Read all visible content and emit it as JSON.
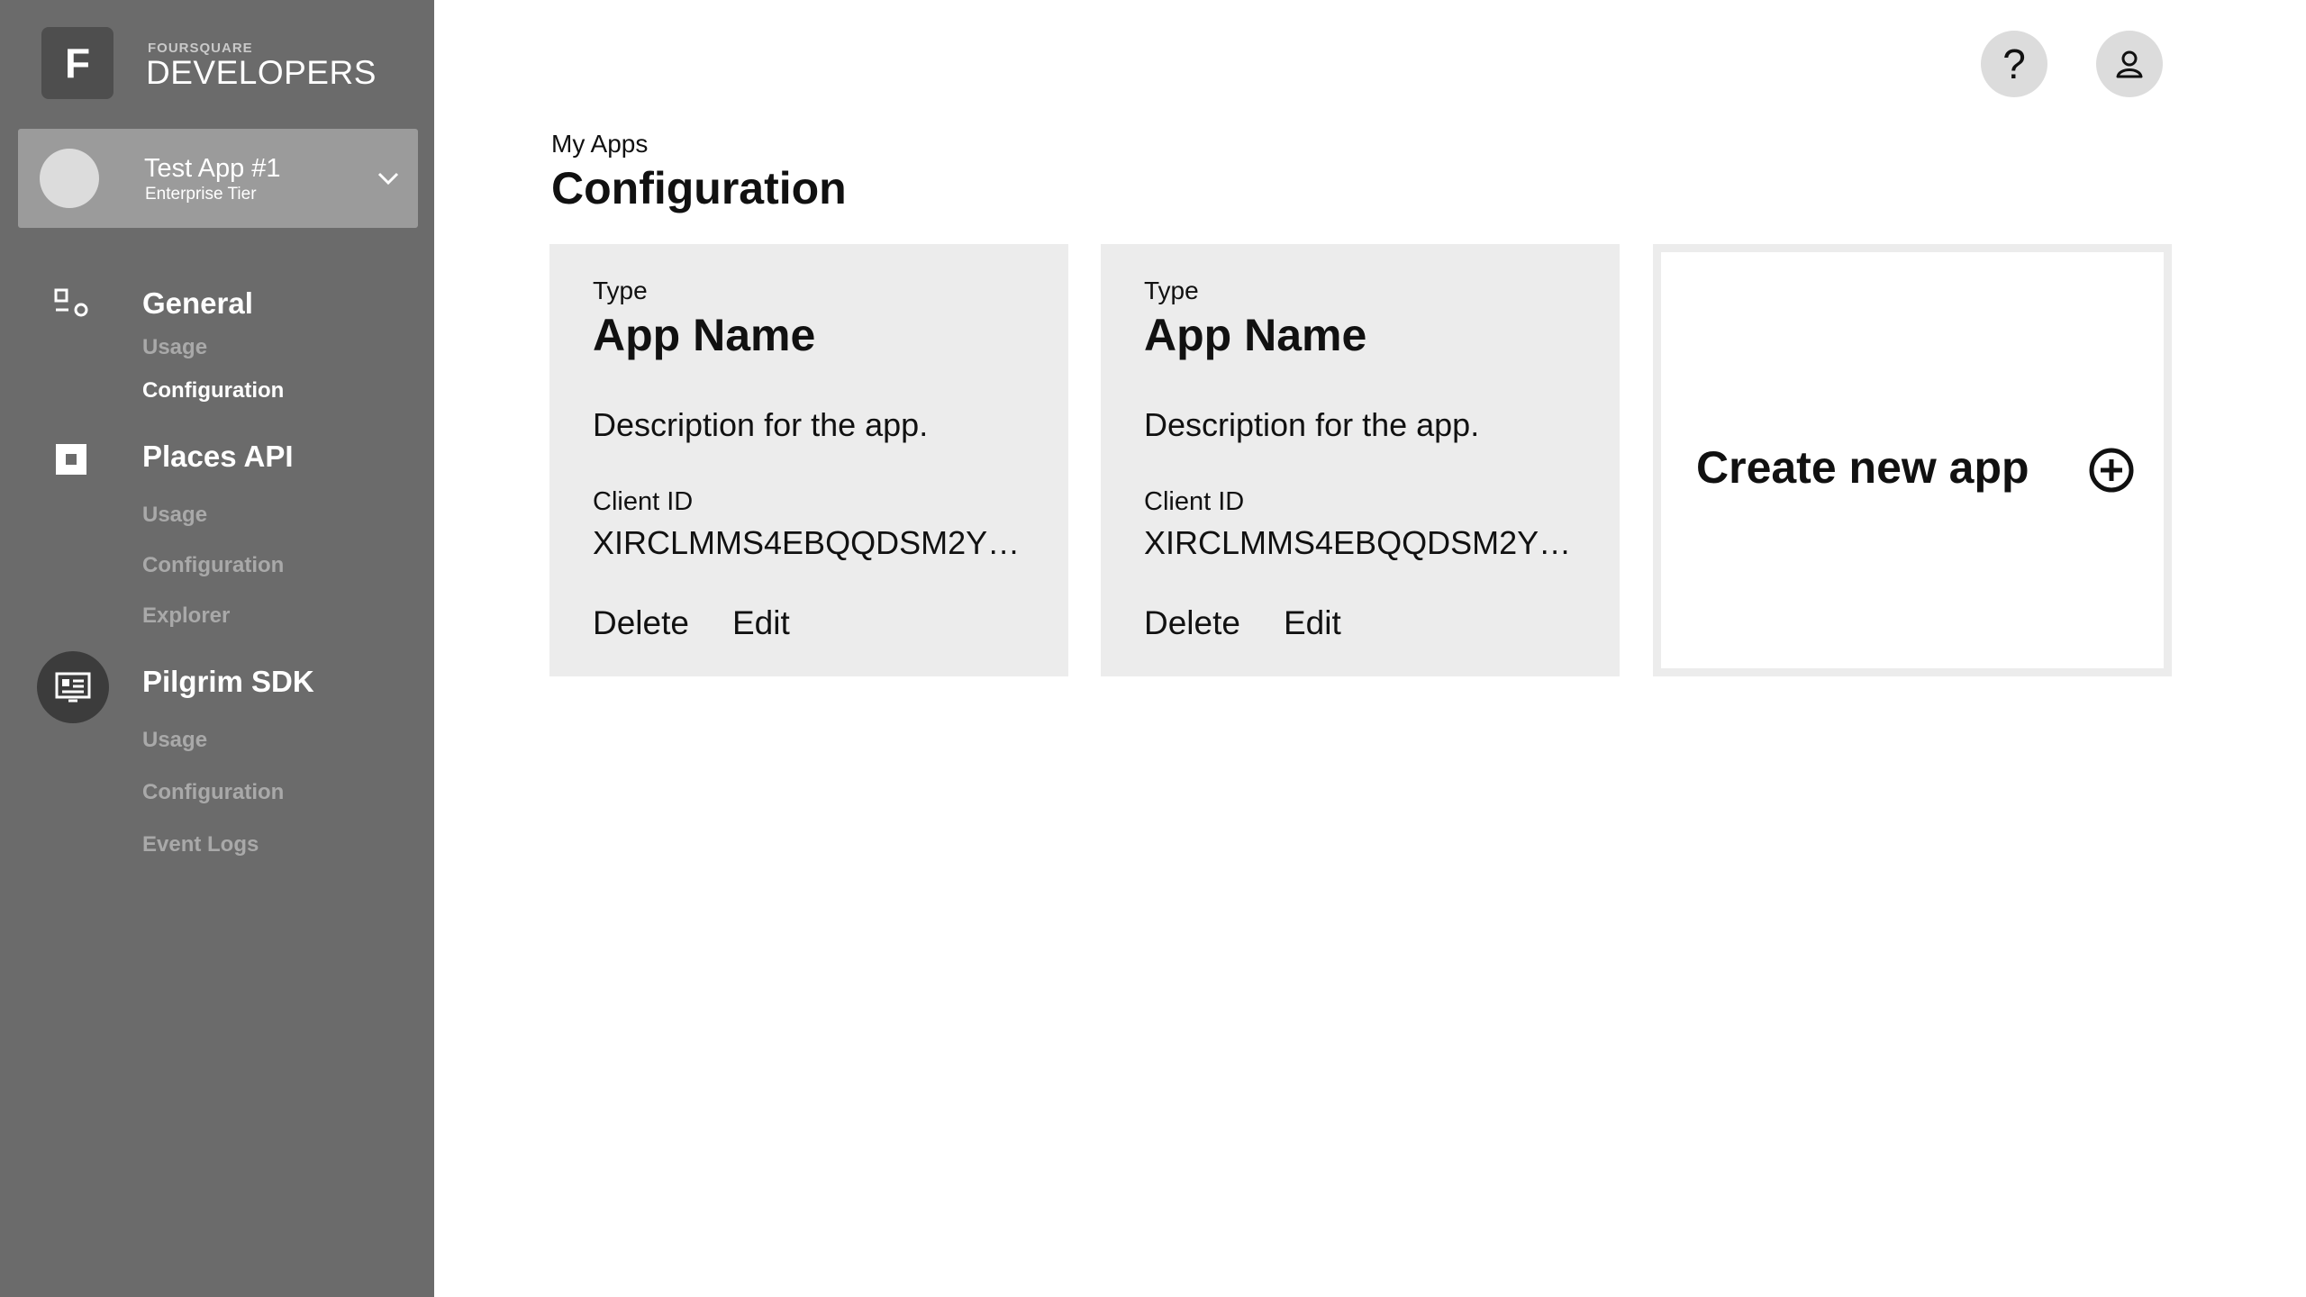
{
  "brand": {
    "logo_letter": "F",
    "small": "FOURSQUARE",
    "big": "DEVELOPERS"
  },
  "app_switcher": {
    "name": "Test App #1",
    "tier": "Enterprise Tier"
  },
  "nav": {
    "general": {
      "label": "General",
      "items": [
        "Usage",
        "Configuration"
      ],
      "active": "Configuration"
    },
    "places": {
      "label": "Places API",
      "items": [
        "Usage",
        "Configuration",
        "Explorer"
      ]
    },
    "pilgrim": {
      "label": "Pilgrim SDK",
      "items": [
        "Usage",
        "Configuration",
        "Event Logs"
      ]
    }
  },
  "header": {
    "help_glyph": "?",
    "icons": [
      "help-icon",
      "user-icon"
    ]
  },
  "page": {
    "breadcrumb": "My Apps",
    "title": "Configuration"
  },
  "cards": [
    {
      "type": "Type",
      "title": "App Name",
      "description": "Description for the app.",
      "client_id_label": "Client ID",
      "client_id": "XIRCLMMS4EBQQDSM2Y…",
      "delete": "Delete",
      "edit": "Edit"
    },
    {
      "type": "Type",
      "title": "App Name",
      "description": "Description for the app.",
      "client_id_label": "Client ID",
      "client_id": "XIRCLMMS4EBQQDSM2Y…",
      "delete": "Delete",
      "edit": "Edit"
    }
  ],
  "create": {
    "label": "Create new app",
    "icon": "plus-circle-icon"
  },
  "colors": {
    "sidebar": "#6b6b6b",
    "card": "#ececec",
    "switcher": "#9b9b9b",
    "logo_box": "#4e4e4e"
  }
}
